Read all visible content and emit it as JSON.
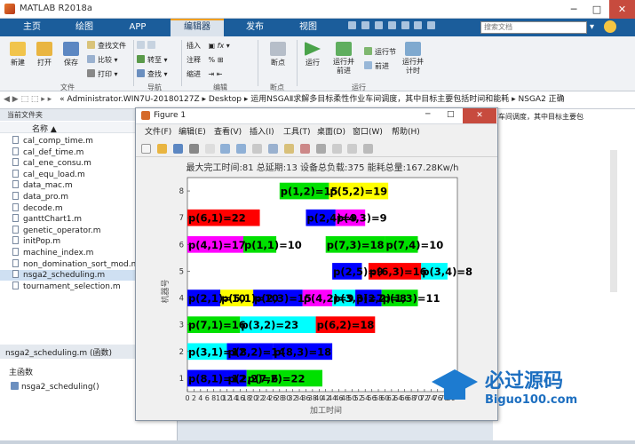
{
  "window": {
    "title": "MATLAB R2018a"
  },
  "tabs": [
    {
      "label": "主页",
      "active": false
    },
    {
      "label": "绘图",
      "active": false
    },
    {
      "label": "APP",
      "active": false
    },
    {
      "label": "编辑器",
      "active": true
    },
    {
      "label": "发布",
      "active": false
    },
    {
      "label": "视图",
      "active": false
    }
  ],
  "search": {
    "placeholder": "搜索文档"
  },
  "toolstrip": {
    "new": "新建",
    "open": "打开",
    "save": "保存",
    "find_files": "查找文件",
    "compare": "比较",
    "print": "打印",
    "insert": "插入",
    "comment": "注释",
    "indent": "缩进",
    "goto": "转至",
    "find": "查找",
    "breakpoint": "断点",
    "run": "运行",
    "run_advance": "运行并\n前进",
    "run_section": "运行节",
    "advance": "前进",
    "run_time": "运行并\n计时",
    "groups": {
      "file": "文件",
      "nav": "导航",
      "edit": "编辑",
      "breakpoints": "断点",
      "run": "运行"
    }
  },
  "address": {
    "path": "« Administrator.WIN7U-20180127Z  ▸  Desktop  ▸  运用NSGAⅡ求解多目标柔性作业车间调度，其中目标主要包括时间和能耗  ▸  NSGA2 正确"
  },
  "folder_panel": {
    "title": "当前文件夹",
    "column": "名称 ▲",
    "files": [
      "cal_comp_time.m",
      "cal_def_time.m",
      "cal_ene_consu.m",
      "cal_equ_load.m",
      "data_mac.m",
      "data_pro.m",
      "decode.m",
      "ganttChart1.m",
      "genetic_operator.m",
      "initPop.m",
      "machine_index.m",
      "non_domination_sort_mod.m",
      "nsga2_scheduling.m",
      "tournament_selection.m"
    ],
    "selected": "nsga2_scheduling.m",
    "detail_title": "nsga2_scheduling.m  (函数)",
    "detail_section": "主函数",
    "detail_item": "nsga2_scheduling()"
  },
  "right_panel": {
    "path_fragment": "车间调度，其中目标主要包"
  },
  "figure": {
    "title": "Figure 1",
    "menu": [
      "文件(F)",
      "编辑(E)",
      "查看(V)",
      "插入(I)",
      "工具(T)",
      "桌面(D)",
      "窗口(W)",
      "帮助(H)"
    ]
  },
  "chart_data": {
    "type": "gantt",
    "title": "最大完工时间:81  总延期:13 设备总负载:375 能耗总量:167.28Kw/h",
    "xlabel": "加工时间",
    "ylabel": "机器号",
    "xlim": [
      0,
      82
    ],
    "ylim": [
      0.5,
      8.5
    ],
    "xticks": [
      0,
      2,
      4,
      6,
      8,
      10,
      12,
      14,
      16,
      18,
      20,
      22,
      24,
      26,
      28,
      30,
      32,
      34,
      36,
      38,
      40,
      42,
      44,
      46,
      48,
      50,
      52,
      54,
      56,
      58,
      60,
      62,
      64,
      66,
      68,
      70,
      72,
      74,
      76,
      78,
      80
    ],
    "yticks": [
      1,
      2,
      3,
      4,
      5,
      6,
      7,
      8
    ],
    "bars": [
      {
        "m": 8,
        "s": 28,
        "e": 43,
        "color": "#00e000",
        "label": "p(1,2)=15"
      },
      {
        "m": 8,
        "s": 43,
        "e": 61,
        "color": "#ffff00",
        "label": "p(5,2)=19"
      },
      {
        "m": 7,
        "s": 0,
        "e": 22,
        "color": "#ff0000",
        "label": "p(6,1)=22"
      },
      {
        "m": 7,
        "s": 36,
        "e": 45,
        "color": "#0000ff",
        "label": "p(2,4)=9"
      },
      {
        "m": 7,
        "s": 45,
        "e": 54,
        "color": "#ff00ff",
        "label": "p(4,3)=9"
      },
      {
        "m": 6,
        "s": 0,
        "e": 17,
        "color": "#ff00ff",
        "label": "p(4,1)=17"
      },
      {
        "m": 6,
        "s": 17,
        "e": 27,
        "color": "#00e000",
        "label": "p(1,1)=10"
      },
      {
        "m": 6,
        "s": 42,
        "e": 60,
        "color": "#00e000",
        "label": "p(7,3)=18"
      },
      {
        "m": 6,
        "s": 60,
        "e": 70,
        "color": "#00e000",
        "label": "p(7,4)=10"
      },
      {
        "m": 5,
        "s": 44,
        "e": 53,
        "color": "#0000ff",
        "label": "p(2,5)=9"
      },
      {
        "m": 5,
        "s": 55,
        "e": 71,
        "color": "#ff0000",
        "label": "p(6,3)=16"
      },
      {
        "m": 5,
        "s": 71,
        "e": 79,
        "color": "#00ffff",
        "label": "p(3,4)=8"
      },
      {
        "m": 4,
        "s": 0,
        "e": 10,
        "color": "#0000ff",
        "label": "p(2,1)=10"
      },
      {
        "m": 4,
        "s": 10,
        "e": 20,
        "color": "#ffff00",
        "label": "p(5,1)=10"
      },
      {
        "m": 4,
        "s": 20,
        "e": 35,
        "color": "#0000ff",
        "label": "p(2,3)=15"
      },
      {
        "m": 4,
        "s": 35,
        "e": 44,
        "color": "#ff00ff",
        "label": "p(4,2)=9"
      },
      {
        "m": 4,
        "s": 44,
        "e": 51,
        "color": "#00ffff",
        "label": "p(3,3)=7"
      },
      {
        "m": 4,
        "s": 51,
        "e": 59,
        "color": "#0000ff",
        "label": "p(2,2)=8"
      },
      {
        "m": 4,
        "s": 59,
        "e": 70,
        "color": "#00e000",
        "label": "p(1,3)=11"
      },
      {
        "m": 3,
        "s": 0,
        "e": 16,
        "color": "#00e000",
        "label": "p(7,1)=16"
      },
      {
        "m": 3,
        "s": 16,
        "e": 39,
        "color": "#00ffff",
        "label": "p(3,2)=23"
      },
      {
        "m": 3,
        "s": 39,
        "e": 57,
        "color": "#ff0000",
        "label": "p(6,2)=18"
      },
      {
        "m": 2,
        "s": 0,
        "e": 12,
        "color": "#00ffff",
        "label": "p(3,1)=12"
      },
      {
        "m": 2,
        "s": 12,
        "e": 26,
        "color": "#0000ff",
        "label": "p(8,2)=14"
      },
      {
        "m": 2,
        "s": 26,
        "e": 44,
        "color": "#0000ff",
        "label": "p(8,3)=18"
      },
      {
        "m": 1,
        "s": 0,
        "e": 12,
        "color": "#0000ff",
        "label": "p(8,1)=12"
      },
      {
        "m": 1,
        "s": 12,
        "e": 18,
        "color": "#0000ff",
        "label": "p(2,2)=6"
      },
      {
        "m": 1,
        "s": 18,
        "e": 41,
        "color": "#00e000",
        "label": "p(7,2)=22"
      }
    ]
  },
  "watermark": {
    "text": "必过源码",
    "url": "Biguo100.com"
  }
}
